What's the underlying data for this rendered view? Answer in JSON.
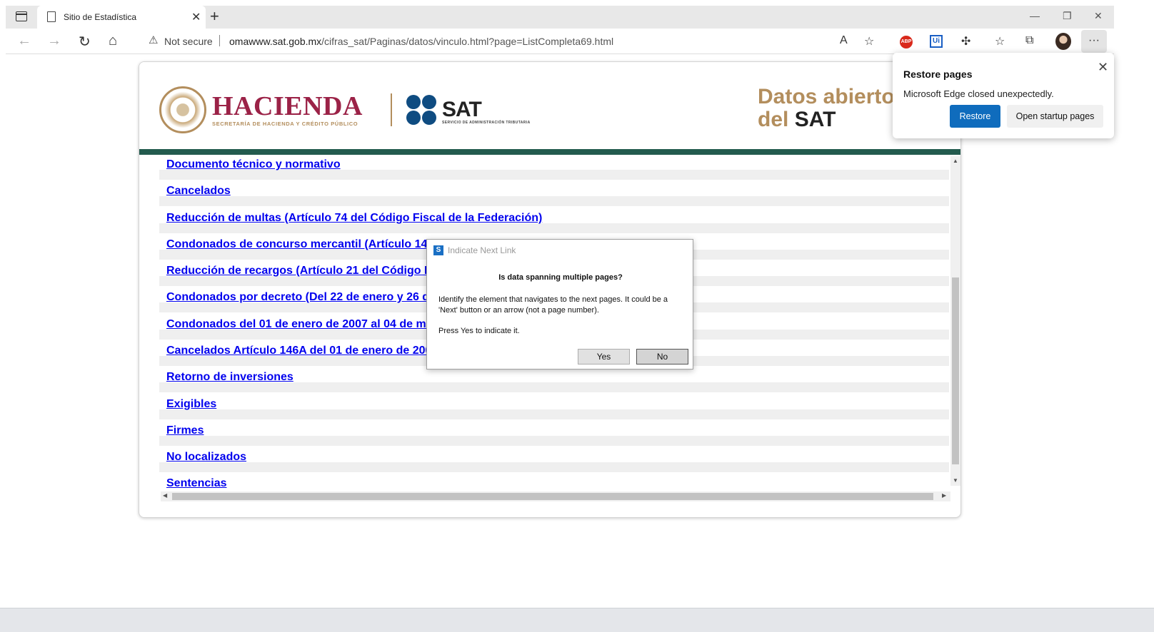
{
  "browser": {
    "tab_title": "Sitio de Estadística",
    "tab_close": "✕",
    "new_tab": "+",
    "window_controls": {
      "minimize": "—",
      "restore": "❐",
      "close": "✕"
    },
    "nav": {
      "back": "←",
      "forward": "→",
      "reload": "↻",
      "home": "⌂"
    },
    "security_label": "Not secure",
    "url_host": "omawww.sat.gob.mx",
    "url_path": "/cifras_sat/Paginas/datos/vinculo.html?page=ListCompleta69.html",
    "read_aloud": "A",
    "extensions": {
      "abp": "ABP",
      "ui": "Ui",
      "puzzle": "✣",
      "favorites": "☆",
      "collections": "⧉",
      "more": "···"
    }
  },
  "header": {
    "hacienda": "HACIENDA",
    "hacienda_sub": "SECRETARÍA DE HACIENDA Y CRÉDITO PÚBLICO",
    "sat": "SAT",
    "sat_sub": "SERVICIO DE ADMINISTRACIÓN TRIBUTARIA",
    "datos_line1": "Datos abiertos",
    "datos_line2a": "del ",
    "datos_line2b": "SAT",
    "brand_colors": {
      "guinda": "#9b2247",
      "dorado": "#b38e5d",
      "verde": "#235b4e",
      "azul": "#0f4c81"
    }
  },
  "links": [
    "Documento técnico y normativo",
    "Cancelados",
    "Reducción de multas (Artículo 74 del Código Fiscal de la Federación)",
    "Condonados de concurso mercantil (Artículo 146",
    "Reducción de recargos (Artículo 21 del Código Fi",
    "Condonados por decreto (Del 22 de enero y 26 de",
    "Condonados del 01 de enero de 2007 al 04 de may",
    "Cancelados Artículo 146A del 01 de enero de 2007",
    "Retorno de inversiones",
    "Exigibles",
    "Firmes",
    "No localizados",
    "Sentencias"
  ],
  "dialog": {
    "title": "Indicate Next Link",
    "question": "Is data spanning multiple pages?",
    "body": "Identify the element that navigates to the next pages. It could be a 'Next' button or an arrow (not a page number).",
    "body2": "Press Yes to indicate it.",
    "yes": "Yes",
    "no": "No"
  },
  "restore": {
    "title": "Restore pages",
    "message": "Microsoft Edge closed unexpectedly.",
    "restore_btn": "Restore",
    "startup_btn": "Open startup pages",
    "close": "✕"
  }
}
